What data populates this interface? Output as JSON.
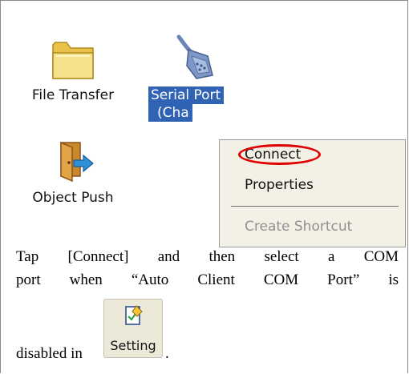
{
  "desktop": {
    "items": [
      {
        "label": "File Transfer",
        "icon": "folder-icon"
      },
      {
        "label_line1": "Serial Port",
        "label_line2": "(Cha",
        "icon": "serial-cable-icon",
        "selected": true
      },
      {
        "label": "Object Push",
        "icon": "door-exit-icon"
      }
    ]
  },
  "context_menu": {
    "items": [
      {
        "label": "Connect",
        "enabled": true,
        "highlighted": true
      },
      {
        "label": "Properties",
        "enabled": true
      },
      {
        "label": "Create Shortcut",
        "enabled": false
      }
    ]
  },
  "caption": {
    "line1": "Tap [Connect] and then select a COM",
    "line2": "port when “Auto Client COM Port” is",
    "line3_prefix": "disabled in",
    "line3_suffix": "."
  },
  "setting_button": {
    "label": "Setting",
    "icon": "setting-page-icon"
  },
  "colors": {
    "selection": "#3163b5",
    "menu_background": "#f3f0e6",
    "highlight_ring": "#e00000",
    "button_face": "#ece9d8"
  }
}
